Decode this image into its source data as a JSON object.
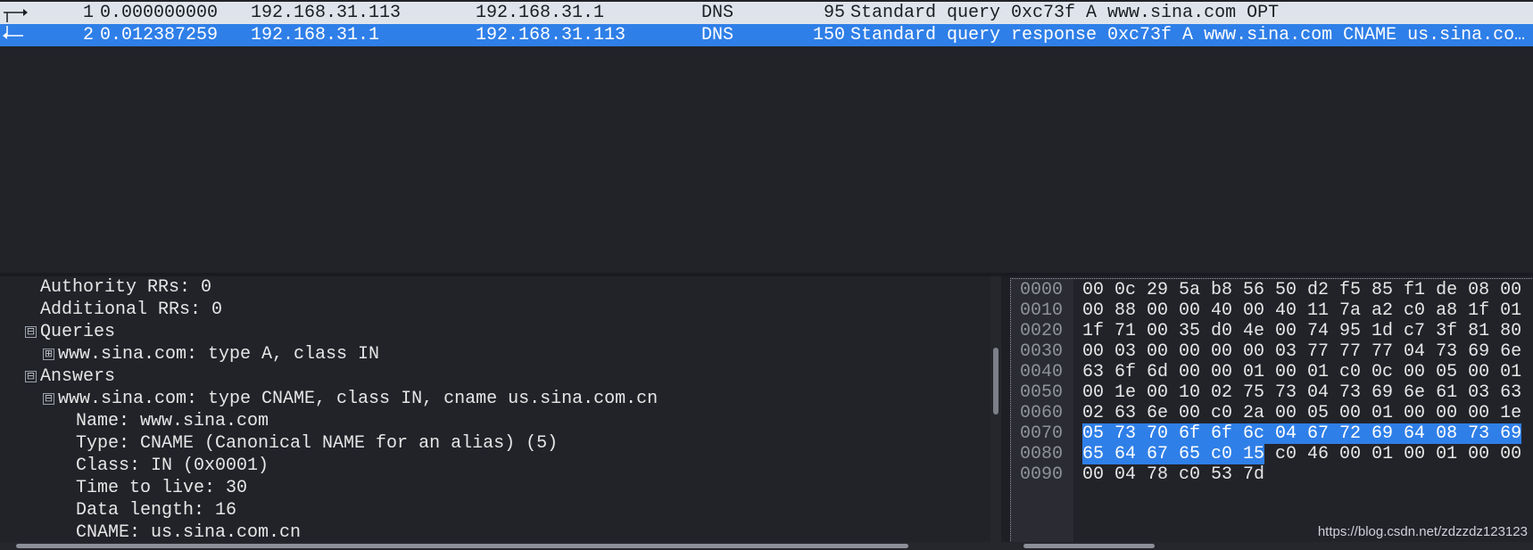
{
  "packet_list": {
    "rows": [
      {
        "no": "1",
        "time": "0.000000000",
        "source": "192.168.31.113",
        "destination": "192.168.31.1",
        "protocol": "DNS",
        "length": "95",
        "info": "Standard query 0xc73f A www.sina.com OPT"
      },
      {
        "no": "2",
        "time": "0.012387259",
        "source": "192.168.31.1",
        "destination": "192.168.31.113",
        "protocol": "DNS",
        "length": "150",
        "info": "Standard query response 0xc73f A www.sina.com CNAME us.sina.co…"
      }
    ]
  },
  "details": {
    "lines": [
      "Authority RRs: 0",
      "Additional RRs: 0",
      "Queries",
      "www.sina.com: type A, class IN",
      "Answers",
      "www.sina.com: type CNAME, class IN, cname us.sina.com.cn",
      "Name: www.sina.com",
      "Type: CNAME (Canonical NAME for an alias) (5)",
      "Class: IN (0x0001)",
      "Time to live: 30",
      "Data length: 16",
      "CNAME: us.sina.com.cn"
    ],
    "toggles": {
      "expanded": "⊟",
      "collapsed": "⊞"
    }
  },
  "bytes": {
    "offsets": [
      "0000",
      "0010",
      "0020",
      "0030",
      "0040",
      "0050",
      "0060",
      "0070",
      "0080",
      "0090"
    ],
    "rows": [
      "00 0c 29 5a b8 56 50 d2  f5 85 f1 de 08 00",
      "00 88 00 00 40 00 40 11  7a a2 c0 a8 1f 01",
      "1f 71 00 35 d0 4e 00 74  95 1d c7 3f 81 80",
      "00 03 00 00 00 00 03 77  77 77 04 73 69 6e",
      "63 6f 6d 00 00 01 00 01  c0 0c 00 05 00 01",
      "00 1e 00 10 02 75 73 04  73 69 6e 61 03 63",
      "02 63 6e 00 c0 2a 00 05  00 01 00 00 00 1e",
      "05 73 70 6f 6f 6c 04 67  72 69 64 08 73 69",
      "65 64 67 65 c0 15",
      "00 04 78 c0 53 7d"
    ],
    "row_0080_tail": " c0 46  00 01 00 01 00 00"
  },
  "watermark": "https://blog.csdn.net/zdzzdz123123",
  "colors": {
    "selected": "#2f7fe8",
    "row_light": "#dfe4ec",
    "background": "#222329"
  }
}
